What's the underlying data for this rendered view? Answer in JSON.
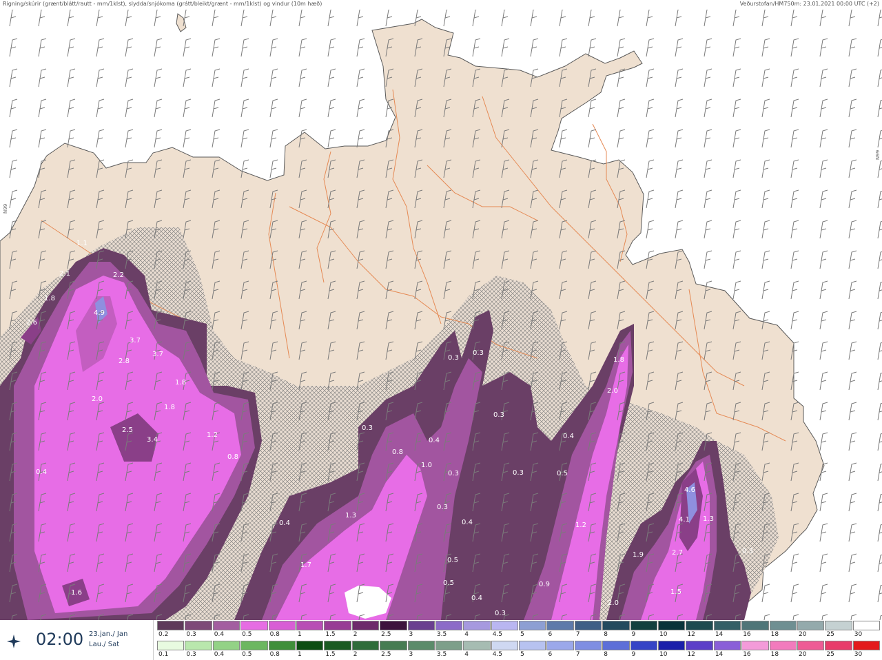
{
  "header": {
    "left": "Rigning/skúrir (grænt/blátt/rautt - mm/1klst), slydda/snjókoma (grátt/bleikt/grænt - mm/1klst) og vindur (10m hæð)",
    "right": "Veðurstofan/HM750m: 23.01.2021 00:00 UTC (+2)"
  },
  "grid_labels": [
    "N99",
    "N99"
  ],
  "colors": {
    "land": "#efe0d0",
    "coast": "#5a5a5a",
    "roads": "#e58a55",
    "barbs": "#777777",
    "precip_light": "#6a3f66",
    "precip_mid": "#a255a0",
    "precip_heavy": "#e76de6",
    "precip_max": "#8f8fdf"
  },
  "precip_labels": [
    {
      "v": "1.1"
    },
    {
      "v": "2.1"
    },
    {
      "v": "2.2"
    },
    {
      "v": "1.8"
    },
    {
      "v": "4.9"
    },
    {
      "v": "2.6"
    },
    {
      "v": "3.7"
    },
    {
      "v": "3.7"
    },
    {
      "v": "2.8"
    },
    {
      "v": "1.8"
    },
    {
      "v": "1.8"
    },
    {
      "v": "2.0"
    },
    {
      "v": "2.5"
    },
    {
      "v": "3.4"
    },
    {
      "v": "1.2"
    },
    {
      "v": "0.8"
    },
    {
      "v": "0.4"
    },
    {
      "v": "0.3"
    },
    {
      "v": "0.3"
    },
    {
      "v": "0.3"
    },
    {
      "v": "0.3"
    },
    {
      "v": "0.4"
    },
    {
      "v": "0.8"
    },
    {
      "v": "1.0"
    },
    {
      "v": "0.3"
    },
    {
      "v": "0.3"
    },
    {
      "v": "0.3"
    },
    {
      "v": "0.4"
    },
    {
      "v": "1.3"
    },
    {
      "v": "0.4"
    },
    {
      "v": "0.5"
    },
    {
      "v": "0.5"
    },
    {
      "v": "1.7"
    },
    {
      "v": "1.6"
    },
    {
      "v": "0.4"
    },
    {
      "v": "0.3"
    },
    {
      "v": "0.9"
    },
    {
      "v": "0.4"
    },
    {
      "v": "0.5"
    },
    {
      "v": "1.2"
    },
    {
      "v": "1.8"
    },
    {
      "v": "2.0"
    },
    {
      "v": "1.9"
    },
    {
      "v": "2.0"
    },
    {
      "v": "4.6"
    },
    {
      "v": "4.1"
    },
    {
      "v": "1.3"
    },
    {
      "v": "2.7"
    },
    {
      "v": "1.5"
    },
    {
      "v": "0.3"
    }
  ],
  "time": {
    "value": "02:00",
    "date_line1": "23.jan./ Jan",
    "date_line2": "Lau./ Sat"
  },
  "legend_snow": [
    {
      "label": "0.2",
      "color": "#5e3a5a"
    },
    {
      "label": "0.3",
      "color": "#7d4a78"
    },
    {
      "label": "0.4",
      "color": "#a35ea0"
    },
    {
      "label": "0.5",
      "color": "#e66de3"
    },
    {
      "label": "0.8",
      "color": "#d85ed5"
    },
    {
      "label": "1",
      "color": "#b84eb5"
    },
    {
      "label": "1.5",
      "color": "#983c95"
    },
    {
      "label": "2",
      "color": "#6d2a6b"
    },
    {
      "label": "2.5",
      "color": "#3d143d"
    },
    {
      "label": "3",
      "color": "#6a3f90"
    },
    {
      "label": "3.5",
      "color": "#8c6bc8"
    },
    {
      "label": "4",
      "color": "#a699df"
    },
    {
      "label": "4.5",
      "color": "#b9b6f1"
    },
    {
      "label": "5",
      "color": "#8d9fd3"
    },
    {
      "label": "6",
      "color": "#5e7aaa"
    },
    {
      "label": "7",
      "color": "#3f5f86"
    },
    {
      "label": "8",
      "color": "#234a5e"
    },
    {
      "label": "9",
      "color": "#12403f"
    },
    {
      "label": "10",
      "color": "#08343a"
    },
    {
      "label": "12",
      "color": "#1d4b50"
    },
    {
      "label": "14",
      "color": "#345f66"
    },
    {
      "label": "16",
      "color": "#4f7578"
    },
    {
      "label": "18",
      "color": "#6f8f92"
    },
    {
      "label": "20",
      "color": "#94aaac"
    },
    {
      "label": "25",
      "color": "#c5d1d2"
    },
    {
      "label": "30",
      "color": "#ffffff"
    }
  ],
  "legend_rain": [
    {
      "label": "0.1",
      "color": "#e8fbe0"
    },
    {
      "label": "0.3",
      "color": "#b9e7ad"
    },
    {
      "label": "0.4",
      "color": "#93d286"
    },
    {
      "label": "0.5",
      "color": "#6cb760"
    },
    {
      "label": "0.8",
      "color": "#3f8f3a"
    },
    {
      "label": "1",
      "color": "#0c4d12"
    },
    {
      "label": "1.5",
      "color": "#1a5a22"
    },
    {
      "label": "2",
      "color": "#2f6c3a"
    },
    {
      "label": "2.5",
      "color": "#467c52"
    },
    {
      "label": "3",
      "color": "#5b8b6a"
    },
    {
      "label": "3.5",
      "color": "#7d9f8a"
    },
    {
      "label": "4",
      "color": "#a6bcb2"
    },
    {
      "label": "4.5",
      "color": "#cfd8f2"
    },
    {
      "label": "5",
      "color": "#b7c2f0"
    },
    {
      "label": "6",
      "color": "#9ba8ea"
    },
    {
      "label": "7",
      "color": "#7f8ee2"
    },
    {
      "label": "8",
      "color": "#5d6fd8"
    },
    {
      "label": "9",
      "color": "#3544c6"
    },
    {
      "label": "10",
      "color": "#1a1faa"
    },
    {
      "label": "12",
      "color": "#5b3ec8"
    },
    {
      "label": "14",
      "color": "#8a5fd8"
    },
    {
      "label": "16",
      "color": "#f39bd9"
    },
    {
      "label": "18",
      "color": "#f27bbd"
    },
    {
      "label": "20",
      "color": "#ee5b95"
    },
    {
      "label": "25",
      "color": "#e83c6a"
    },
    {
      "label": "30",
      "color": "#e31a1c"
    }
  ]
}
